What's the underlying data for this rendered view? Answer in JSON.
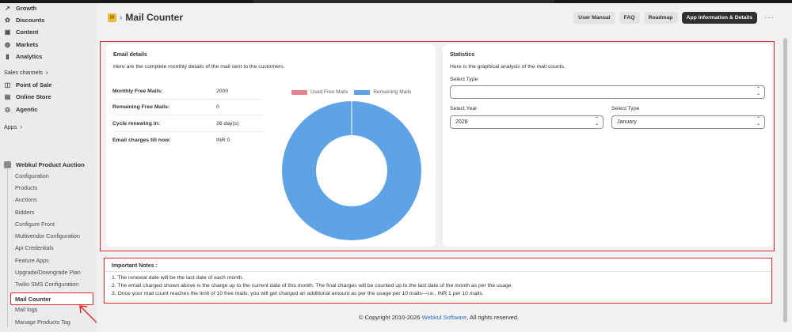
{
  "sidebar": {
    "items": [
      {
        "label": "Growth",
        "icon": "growth-icon"
      },
      {
        "label": "Discounts",
        "icon": "discount-icon"
      },
      {
        "label": "Content",
        "icon": "content-icon"
      },
      {
        "label": "Markets",
        "icon": "globe-icon"
      },
      {
        "label": "Analytics",
        "icon": "analytics-icon"
      }
    ],
    "sales_channels_label": "Sales channels",
    "channels": [
      {
        "label": "Point of Sale",
        "icon": "pos-icon"
      },
      {
        "label": "Online Store",
        "icon": "store-icon"
      },
      {
        "label": "Agentic",
        "icon": "agentic-icon"
      }
    ],
    "apps_label": "Apps",
    "app_name": "Webkul Product Auction",
    "app_subitems": [
      "Configuration",
      "Products",
      "Auctions",
      "Bidders",
      "Configure Front",
      "Multivendor Configuration",
      "Api Credentials",
      "Feature Apps",
      "Upgrade/Downgrade Plan",
      "Twilio SMS Configuration"
    ],
    "active_item": "Mail Counter",
    "after_items": [
      "Mail logs",
      "Manage Products Tag"
    ]
  },
  "header": {
    "title": "Mail Counter",
    "buttons": [
      "User Manual",
      "FAQ",
      "Roadmap",
      "App Information & Details"
    ]
  },
  "email_details": {
    "title": "Email details",
    "subtitle": "Here are the complete monthly details of the mail sent to the customers.",
    "rows": [
      {
        "label": "Monthly Free Mails:",
        "value": "2000"
      },
      {
        "label": "Remaining Free Mails:",
        "value": "0"
      },
      {
        "label": "Cycle renewing in:",
        "value": "26 day(s)"
      },
      {
        "label": "Email charges till now:",
        "value": "INR 0"
      }
    ],
    "chart_data": {
      "type": "pie",
      "categories": [
        "Used Free Mails",
        "Remaining Mails"
      ],
      "values": [
        0,
        100
      ],
      "colors": [
        "#e8828f",
        "#5ea3e6"
      ],
      "legend": "top"
    }
  },
  "statistics": {
    "title": "Statistics",
    "subtitle": "Here is the graphical analysis of the mail counts.",
    "select_type_label": "Select Type",
    "select_type_value": "",
    "select_year_label": "Select Year",
    "select_year_value": "2026",
    "select_type2_label": "Select Type",
    "select_type2_value": "January"
  },
  "notes": {
    "title": "Important Notes :",
    "lines": [
      "1. The renewal date will be the last date of each month.",
      "2. The email charged shown above is the charge up to the current date of this month. The final charges will be counted up to the last date of the month as per the usage.",
      "3. Once your mail count reaches the limit of 10 free mails, you will get charged an additional amount as per the usage per 10 mails—i.e., INR 1 per 10 mails."
    ]
  },
  "footer": {
    "prefix": "© Copyright 2010-2026 ",
    "link": "Webkul Software",
    "suffix": ", All rights reserved."
  }
}
